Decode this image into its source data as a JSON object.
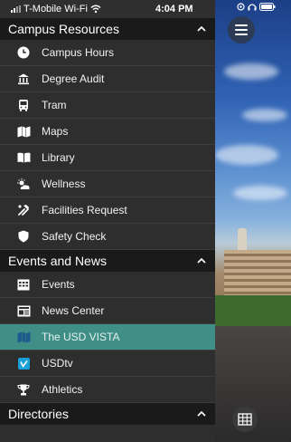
{
  "status_bar": {
    "carrier": "T-Mobile Wi-Fi",
    "time": "4:04 PM"
  },
  "sections": [
    {
      "title": "Campus Resources",
      "items": [
        {
          "label": "Campus Hours",
          "icon": "clock-icon"
        },
        {
          "label": "Degree Audit",
          "icon": "institution-icon"
        },
        {
          "label": "Tram",
          "icon": "bus-icon"
        },
        {
          "label": "Maps",
          "icon": "map-icon"
        },
        {
          "label": "Library",
          "icon": "book-icon"
        },
        {
          "label": "Wellness",
          "icon": "weather-icon"
        },
        {
          "label": "Facilities Request",
          "icon": "tools-icon"
        },
        {
          "label": "Safety Check",
          "icon": "shield-icon"
        }
      ]
    },
    {
      "title": "Events and News",
      "items": [
        {
          "label": "Events",
          "icon": "calendar-grid-icon"
        },
        {
          "label": "News Center",
          "icon": "newspaper-icon"
        },
        {
          "label": "The USD VISTA",
          "icon": "map-icon",
          "active": true
        },
        {
          "label": "USDtv",
          "icon": "vimeo-icon"
        },
        {
          "label": "Athletics",
          "icon": "trophy-icon"
        }
      ]
    },
    {
      "title": "Directories",
      "items": []
    }
  ],
  "colors": {
    "active_row": "#3f8f86",
    "header_bg": "#1a1a1a",
    "drawer_bg": "#2e2e2e",
    "toggle_bg": "#2d3b57"
  }
}
